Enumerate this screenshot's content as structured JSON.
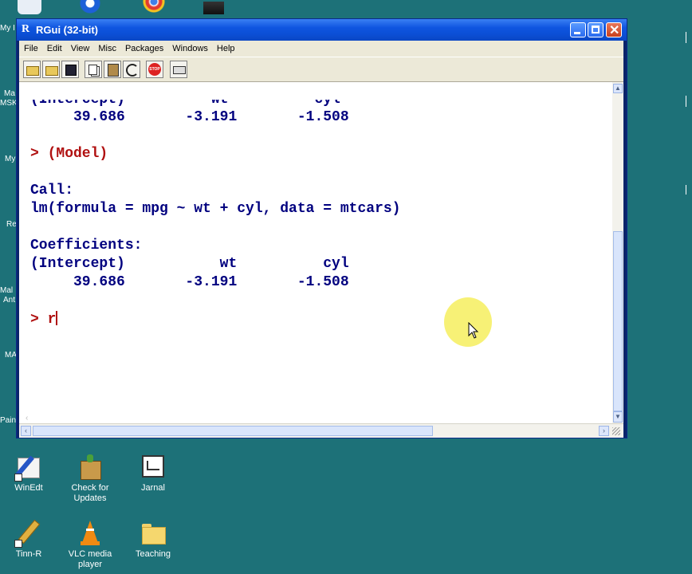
{
  "window": {
    "title": "RGui (32-bit)",
    "title_icon": "R"
  },
  "menu": [
    "File",
    "Edit",
    "View",
    "Misc",
    "Packages",
    "Windows",
    "Help"
  ],
  "toolbar": {
    "buttons": [
      "open-script-icon",
      "load-workspace-icon",
      "save-icon",
      "copy-icon",
      "paste-icon",
      "copy-paste-icon",
      "stop-icon",
      "print-icon"
    ],
    "stop_label": "STOP"
  },
  "console": {
    "lines": [
      {
        "text": "(Intercept)          wt          cyl",
        "color": "blue"
      },
      {
        "text": "     39.686       -3.191       -1.508",
        "color": "blue"
      },
      {
        "text": "> (Model)",
        "color": "red"
      },
      {
        "text": "Call:",
        "color": "blue"
      },
      {
        "text": "lm(formula = mpg ~ wt + cyl, data = mtcars)",
        "color": "blue"
      },
      {
        "text": "Coefficients:",
        "color": "blue"
      },
      {
        "text": "(Intercept)           wt          cyl",
        "color": "blue"
      },
      {
        "text": "     39.686       -3.191       -1.508",
        "color": "blue"
      },
      {
        "text": "> r",
        "color": "red"
      }
    ]
  },
  "desktop": {
    "edge_labels": [
      "My I",
      "Ma",
      "MSK",
      "My",
      "Re",
      "Mal",
      "Ant",
      "MA",
      "Pain"
    ],
    "icons": [
      {
        "label": "WinEdt",
        "icon": "winedt-icon"
      },
      {
        "label": "Check for Updates",
        "icon": "package-icon"
      },
      {
        "label": "Jarnal",
        "icon": "jarnal-icon"
      },
      {
        "label": "Tinn-R",
        "icon": "pencil-icon"
      },
      {
        "label": "VLC media player",
        "icon": "vlc-cone-icon"
      },
      {
        "label": "Teaching",
        "icon": "folder-icon"
      }
    ]
  },
  "colors": {
    "desktop": "#1d7178",
    "output_text": "#00007f",
    "input_text": "#b01010",
    "cursor_highlight": "#f6f06a"
  }
}
